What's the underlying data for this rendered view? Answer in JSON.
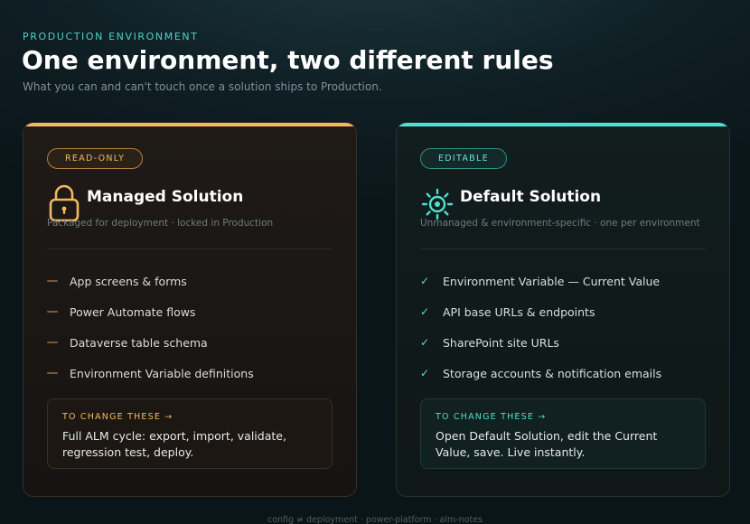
{
  "header": {
    "eyebrow": "PRODUCTION ENVIRONMENT",
    "title": "One environment, two different rules",
    "subtitle": "What you can and can't touch once a solution ships to Production."
  },
  "colors": {
    "managed_accent": "#f4b860",
    "default_accent": "#4fe0cf"
  },
  "managed": {
    "badge": "READ-ONLY",
    "icon": "lock-icon",
    "title": "Managed Solution",
    "subtitle": "Packaged for deployment · locked in Production",
    "items": [
      {
        "label": "App screens & forms"
      },
      {
        "label": "Power Automate flows"
      },
      {
        "label": "Dataverse table schema"
      },
      {
        "label": "Environment Variable definitions"
      }
    ],
    "change_label": "TO CHANGE THESE →",
    "change_text": "Full ALM cycle: export, import, validate, regression test, deploy."
  },
  "default": {
    "badge": "EDITABLE",
    "icon": "gear-icon",
    "title": "Default Solution",
    "subtitle": "Unmanaged & environment-specific · one per environment",
    "items": [
      {
        "label": "Environment Variable — Current Value"
      },
      {
        "label": "API base URLs & endpoints"
      },
      {
        "label": "SharePoint site URLs"
      },
      {
        "label": "Storage accounts & notification emails"
      }
    ],
    "change_label": "TO CHANGE THESE →",
    "change_text": "Open Default Solution, edit the Current Value, save. Live instantly."
  },
  "footer": "config ≠ deployment · power-platform · alm-notes"
}
